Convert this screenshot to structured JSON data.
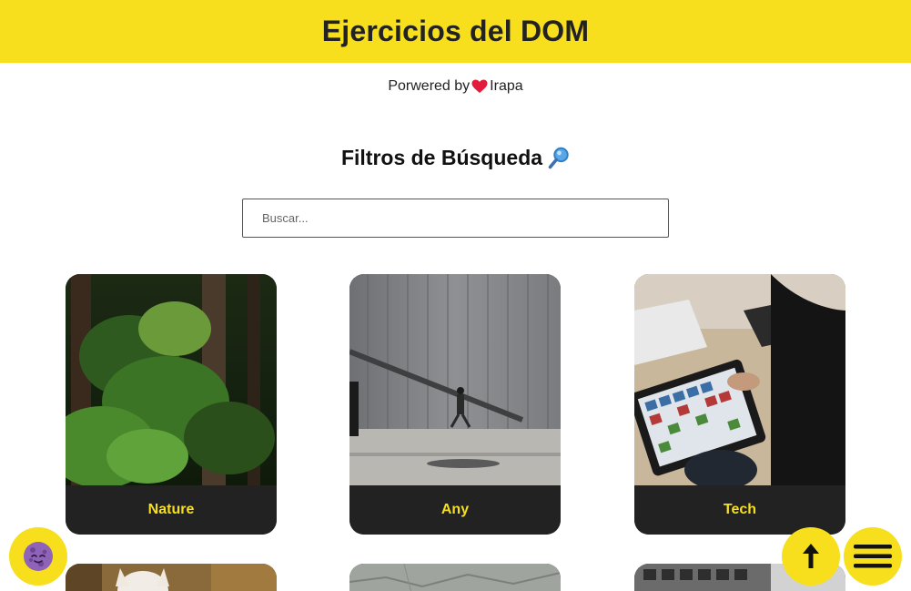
{
  "header": {
    "title": "Ejercicios del DOM"
  },
  "credit": {
    "prefix": "Porwered by",
    "author": "Irapa"
  },
  "filters": {
    "title": "Filtros de Búsqueda",
    "search_placeholder": "Buscar..."
  },
  "cards": [
    {
      "label": "Nature"
    },
    {
      "label": "Any"
    },
    {
      "label": "Tech"
    }
  ],
  "colors": {
    "accent": "#f7df1e",
    "card_bg": "#222222",
    "text": "#222222"
  },
  "icons": {
    "theme_toggle": "moon-icon",
    "scroll_top": "arrow-up-icon",
    "menu": "hamburger-icon",
    "heart": "heart-icon",
    "magnifier": "magnifier-icon"
  }
}
